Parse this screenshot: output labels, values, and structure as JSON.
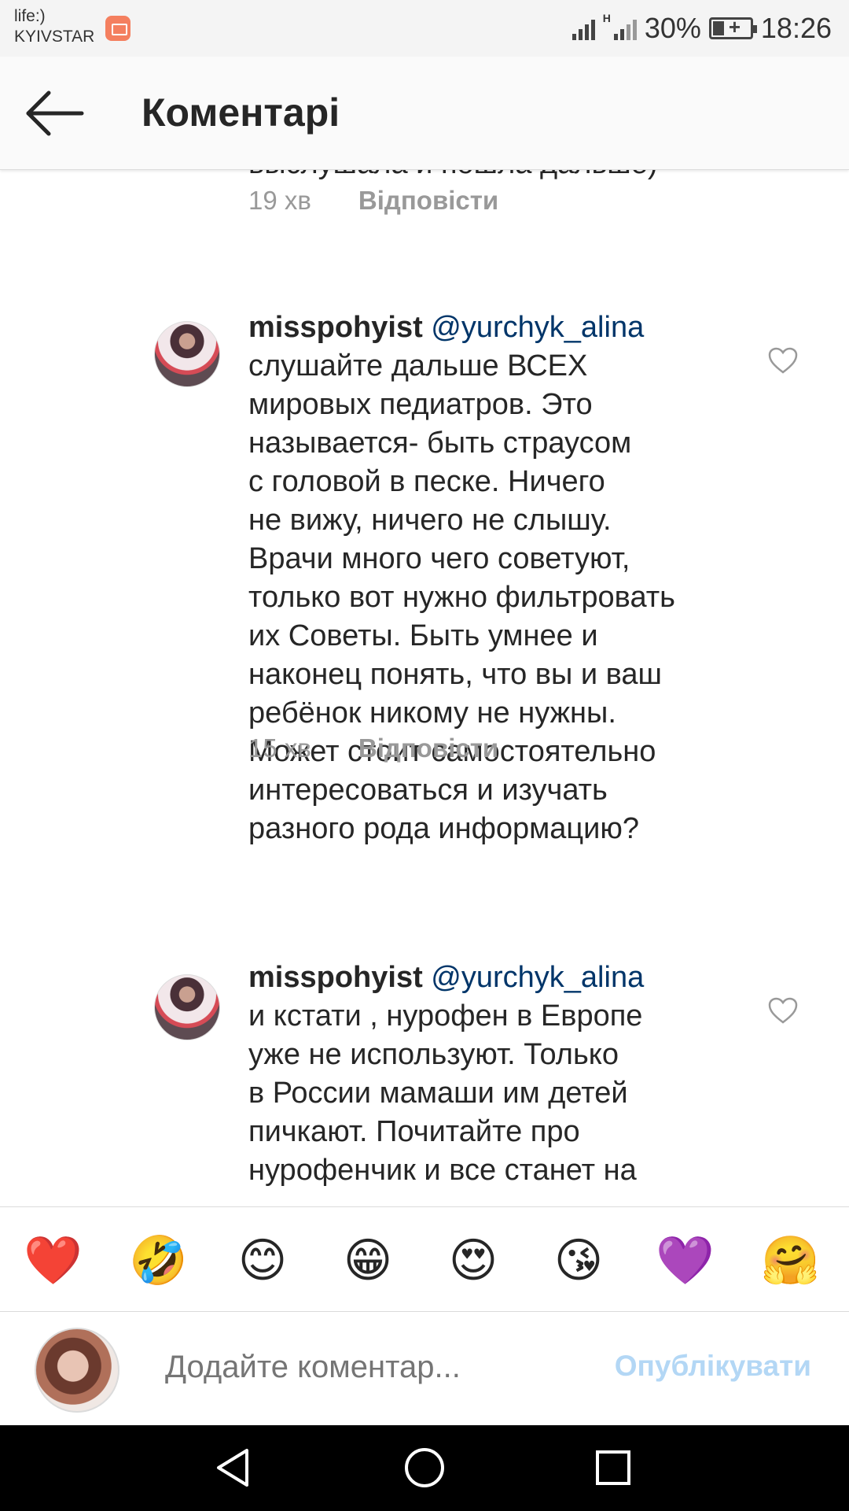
{
  "status_bar": {
    "carrier_1": "life:)",
    "carrier_2": "KYIVSTAR",
    "network_type": "H",
    "battery": "30%",
    "time": "18:26"
  },
  "header": {
    "title": "Коментарі"
  },
  "comments": [
    {
      "text_lines": [
        "выслушала и пошла дальше)"
      ],
      "time": "19 хв",
      "reply_label": "Відповісти"
    },
    {
      "username": "misspohyist",
      "mention": "@yurchyk_alina",
      "text_lines": [
        "слушайте дальше ВСЕХ",
        "мировых педиатров. Это",
        "называется- быть страусом",
        "с головой в песке. Ничего",
        "не вижу, ничего не слышу.",
        "Врачи много чего советуют,",
        "только вот нужно фильтровать",
        "их Советы. Быть умнее и",
        "наконец понять, что вы и ваш",
        "ребёнок никому не нужны.",
        "Может стоит самостоятельно",
        "интересоваться и изучать",
        "разного рода информацию?"
      ],
      "time": "15 хв",
      "reply_label": "Відповісти"
    },
    {
      "username": "misspohyist",
      "mention": "@yurchyk_alina",
      "text_lines": [
        "и кстати , нурофен в Европе",
        "уже не используют. Только",
        "в России мамаши им детей",
        "пичкают. Почитайте про",
        "нурофенчик и все станет на"
      ]
    }
  ],
  "emoji_bar": [
    "❤️",
    "🤣",
    "😊",
    "😁",
    "😍",
    "😘",
    "💜",
    "🤗"
  ],
  "input": {
    "placeholder": "Додайте коментар...",
    "publish_label": "Опублікувати"
  },
  "colors": {
    "mention": "#003569",
    "muted": "#999999",
    "publish_disabled": "#b3d7f5"
  }
}
